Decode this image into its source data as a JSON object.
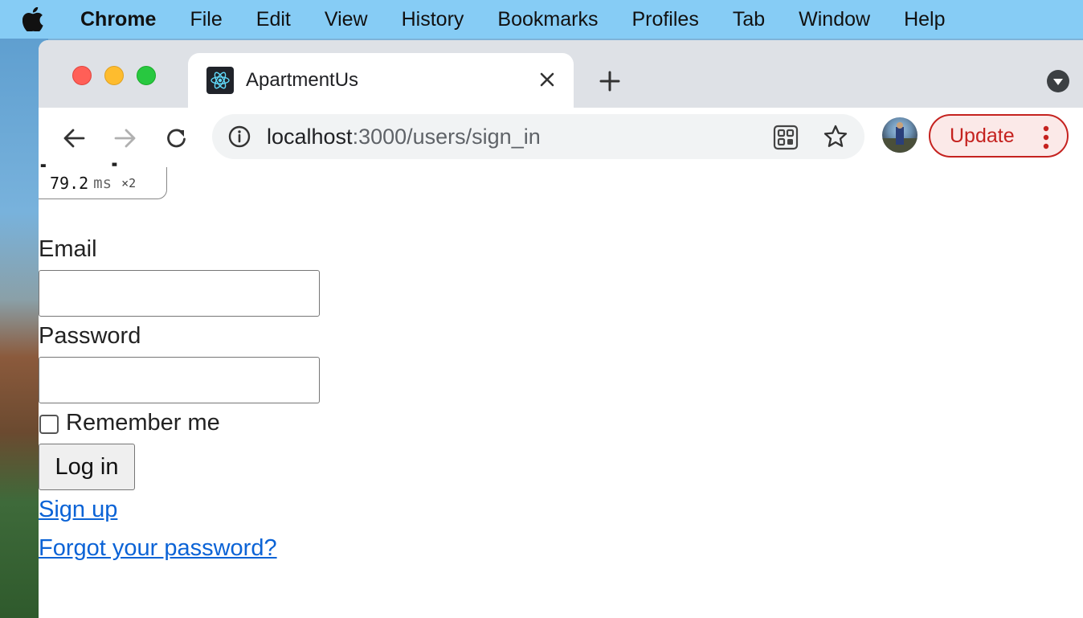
{
  "menubar": {
    "app_name": "Chrome",
    "items": [
      "File",
      "Edit",
      "View",
      "History",
      "Bookmarks",
      "Profiles",
      "Tab",
      "Window",
      "Help"
    ]
  },
  "tab": {
    "title": "ApartmentUs",
    "favicon": "react-icon"
  },
  "toolbar": {
    "url_host": "localhost",
    "url_path": ":3000/users/sign_in",
    "update_label": "Update"
  },
  "perf_badge": {
    "value": "79.2",
    "unit": "ms",
    "multiplier": "×2"
  },
  "page": {
    "heading": "Log in",
    "email_label": "Email",
    "email_value": "",
    "password_label": "Password",
    "password_value": "",
    "remember_label": "Remember me",
    "remember_checked": false,
    "submit_label": "Log in",
    "signup_link": "Sign up",
    "forgot_link": "Forgot your password?"
  },
  "colors": {
    "menubar_bg": "#86ccf5",
    "update_accent": "#c5221f",
    "link": "#0b63d6"
  }
}
